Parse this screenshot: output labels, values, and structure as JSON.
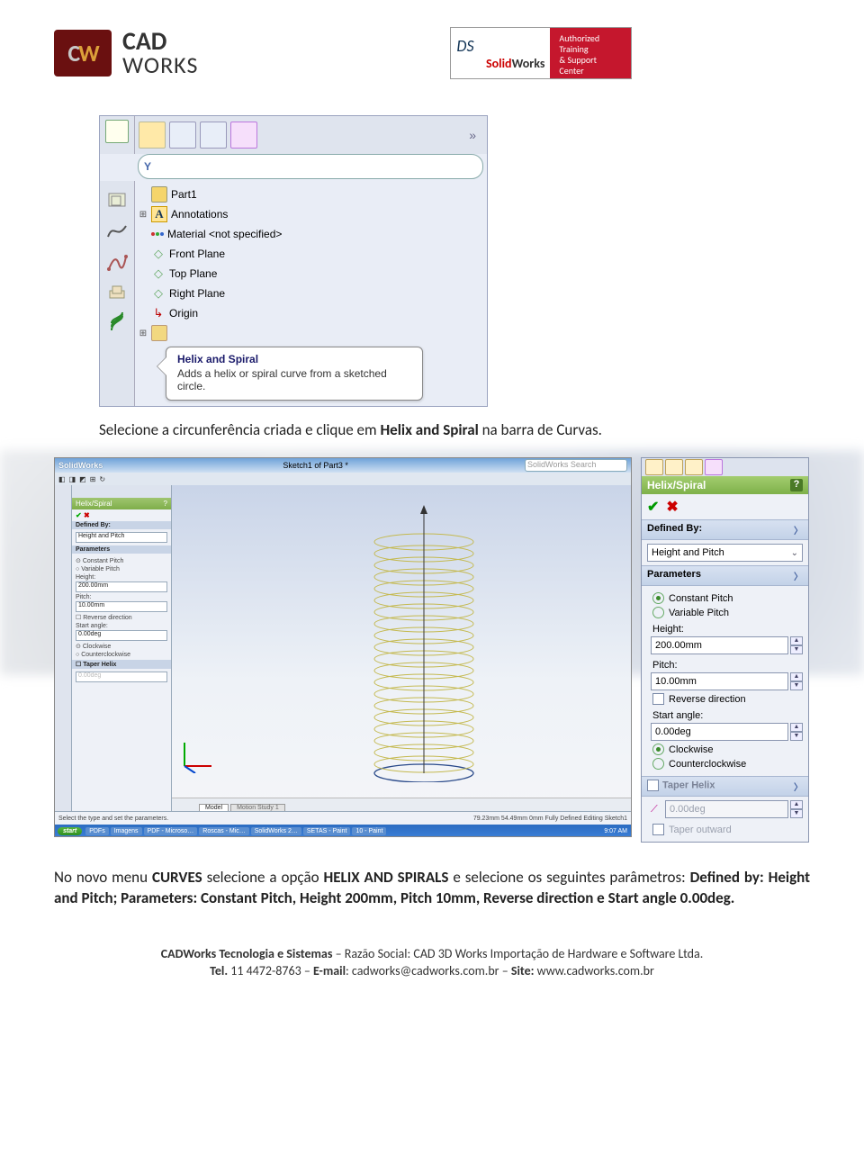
{
  "header": {
    "left": {
      "badge_c": "C",
      "badge_w": "W",
      "line1": "CAD",
      "line2": "WORKS"
    },
    "right": {
      "ds": "DS",
      "brand_s": "Solid",
      "brand_w": "Works",
      "red_text": "Authorized\nTraining\n& Support\nCenter"
    }
  },
  "shot1": {
    "filter_initial": "Y",
    "tree": {
      "part": "Part1",
      "annotations": "Annotations",
      "material": "Material <not specified>",
      "front": "Front Plane",
      "top": "Top Plane",
      "right": "Right Plane",
      "origin": "Origin"
    },
    "tooltip": {
      "title": "Helix and Spiral",
      "desc": "Adds a helix or spiral curve from a sketched circle."
    }
  },
  "caption1": {
    "pre": "Selecione a circunferência criada e clique em ",
    "bold": "Helix and Spiral",
    "post": " na barra de Curvas."
  },
  "shot2": {
    "brand": "SolidWorks",
    "doc": "Sketch1 of Part3 *",
    "search_placeholder": "SolidWorks Search",
    "panel": {
      "title": "Helix/Spiral",
      "sec_def": "Defined By:",
      "def_val": "Height and Pitch",
      "sec_par": "Parameters",
      "r_const": "Constant Pitch",
      "r_var": "Variable Pitch",
      "l_height": "Height:",
      "v_height": "200.00mm",
      "l_pitch": "Pitch:",
      "v_pitch": "10.00mm",
      "chk_rev": "Reverse direction",
      "l_start": "Start angle:",
      "v_start": "0.00deg",
      "r_cw": "Clockwise",
      "r_ccw": "Counterclockwise",
      "sec_taper": "Taper Helix"
    },
    "status_left": "Select the type and set the parameters.",
    "status_right": "79.23mm   54.49mm  0mm  Fully Defined   Editing Sketch1",
    "modeltabs": {
      "model": "Model",
      "motion": "Motion Study 1"
    },
    "taskbar": {
      "start": "start",
      "items": [
        "PDFs",
        "Imagens",
        "PDF - Microso…",
        "Roscas - Mic…",
        "SolidWorks 2…",
        "SETAS - Paint",
        "10 - Paint"
      ],
      "clock": "9:07 AM"
    }
  },
  "shot3": {
    "title": "Helix/Spiral",
    "sec_def": "Defined By:",
    "def_val": "Height and Pitch",
    "sec_par": "Parameters",
    "r_const": "Constant Pitch",
    "r_var": "Variable Pitch",
    "l_height": "Height:",
    "v_height": "200.00mm",
    "l_pitch": "Pitch:",
    "v_pitch": "10.00mm",
    "chk_rev": "Reverse direction",
    "l_start": "Start angle:",
    "v_start": "0.00deg",
    "r_cw": "Clockwise",
    "r_ccw": "Counterclockwise",
    "sec_taper": "Taper Helix",
    "v_taper": "0.00deg",
    "chk_taper_out": "Taper outward"
  },
  "caption2": {
    "t1": "No novo menu ",
    "b1": "CURVES",
    "t2": " selecione a opção ",
    "b2": "HELIX AND SPIRALS",
    "t3": " e selecione os seguintes parâmetros: ",
    "b3": "Defined by: Height and Pitch; Parameters: Constant Pitch, Height 200mm, Pitch 10mm, Reverse direction e Start angle 0.00deg."
  },
  "footer": {
    "l1a": "CADWorks Tecnologia e Sistemas",
    "l1b": " – Razão Social: CAD 3D Works Importação de Hardware e Software Ltda.",
    "l2_tel_lbl": "Tel.",
    "l2_tel": " 11 4472-8763 – ",
    "l2_em_lbl": "E-mail",
    "l2_em": ": cadworks@cadworks.com.br – ",
    "l2_site_lbl": "Site:",
    "l2_site": " www.cadworks.com.br"
  }
}
